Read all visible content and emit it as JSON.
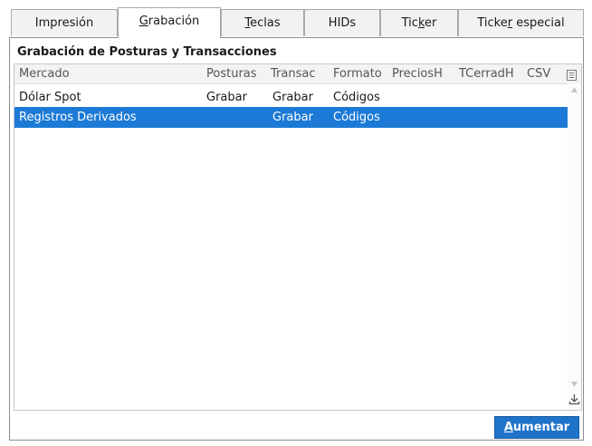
{
  "tabs": [
    {
      "label": "Impresión"
    },
    {
      "label_pre": "",
      "label_u": "G",
      "label_post": "rabación"
    },
    {
      "label_pre": "",
      "label_u": "T",
      "label_post": "eclas"
    },
    {
      "label": "HIDs"
    },
    {
      "label_pre": "Tic",
      "label_u": "k",
      "label_post": "er"
    },
    {
      "label_pre": "Ticke",
      "label_u": "r",
      "label_post": " especial"
    }
  ],
  "section": {
    "title": "Grabación de Posturas y Transacciones"
  },
  "table": {
    "columns": [
      "Mercado",
      "Posturas",
      "Transac",
      "Formato",
      "PreciosH",
      "TCerradH",
      "CSV"
    ],
    "rows": [
      {
        "mercado": "Dólar Spot",
        "posturas": "Grabar",
        "transac": "Grabar",
        "formato": "Códigos"
      },
      {
        "mercado": "Registros Derivados",
        "posturas": "",
        "transac": "Grabar",
        "formato": "Códigos"
      }
    ],
    "selected_row": 1
  },
  "button": {
    "label_u": "A",
    "label_post": "umentar"
  },
  "icons": {
    "column_menu": "column-menu-icon",
    "scroll_up": "scroll-up-arrow-icon",
    "scroll_down": "scroll-down-arrow-icon",
    "download": "download-icon"
  },
  "colors": {
    "selection": "#1c7ad6",
    "button": "#1f73c9"
  }
}
